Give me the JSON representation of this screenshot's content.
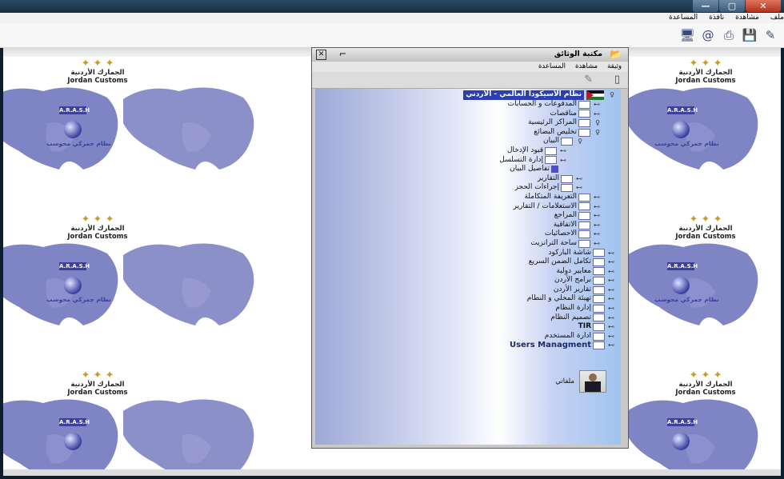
{
  "window": {
    "min": "—",
    "max": "▢",
    "close": "✕"
  },
  "menubar": {
    "items": [
      "ملف",
      "مشاهدة",
      "نافذة",
      "المساعدة"
    ]
  },
  "toolbar": {
    "icons": [
      "open-icon",
      "email-icon",
      "print-icon",
      "disk-icon",
      "edit-icon"
    ]
  },
  "background_tile": {
    "ar": "الجمارك الأردنية",
    "en": "Jordan Customs",
    "badge": "A.R.A.S.H",
    "caption": "نظام جمركي محوسب"
  },
  "doc_window": {
    "title": "مكتبة الوثائق",
    "menu": [
      "وثيقة",
      "مشاهدة",
      "المساعدة"
    ],
    "tree": {
      "root": "نظام الأسيكودا العالمي - الأردني",
      "items": [
        "المدفوعات و الحسابات",
        "مناقصات",
        "المراكز الرئيسية",
        "تخليص البضائع",
        "البيان",
        "قيود الإدخال",
        "إدارة التسلسل",
        "تفاصيل البيان",
        "التقارير",
        "إجراءات الحجز",
        "التعريفة المتكاملة",
        "الاستعلامات / التقارير",
        "المراجع",
        "الاتفاقية",
        "الاحصائيات",
        "ساحة الترانزيت",
        "شاشة الباركود",
        "تكامل الضمن السريع",
        "معايير دولية",
        "برامج الأردن",
        "تقارير الأردن",
        "تهيئة المحلي و النطام",
        "إدارة النظام",
        "تصميم النظام",
        "TIR",
        "ادارة المستخدم",
        "Users Managment"
      ]
    },
    "profile_label": "ملفاتي"
  }
}
